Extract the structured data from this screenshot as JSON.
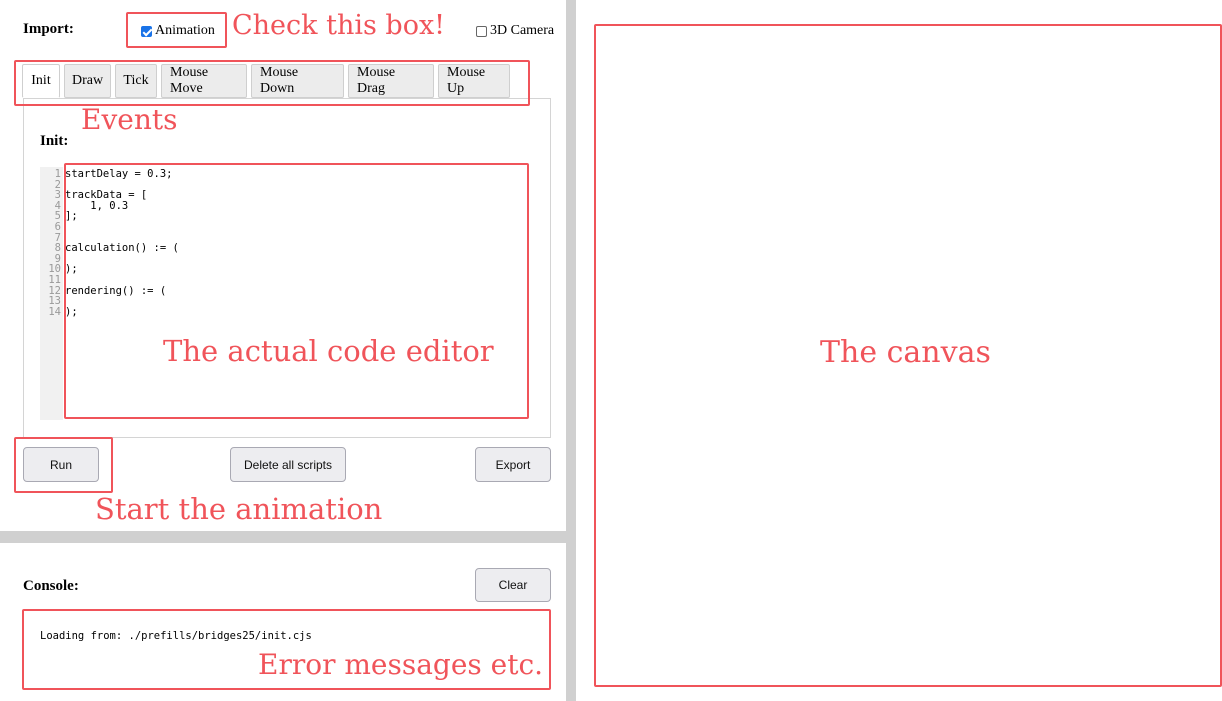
{
  "import": {
    "label": "Import:",
    "animation_label": "Animation",
    "animation_checked": true,
    "camera_label": "3D Camera",
    "camera_checked": false
  },
  "tabs": [
    {
      "label": "Init",
      "active": true
    },
    {
      "label": "Draw"
    },
    {
      "label": "Tick"
    },
    {
      "label": "Mouse Move"
    },
    {
      "label": "Mouse Down"
    },
    {
      "label": "Mouse Drag"
    },
    {
      "label": "Mouse Up"
    }
  ],
  "editor": {
    "heading": "Init:",
    "lines": [
      {
        "num": "1",
        "text": "startDelay = 0.3;"
      },
      {
        "num": "2",
        "text": ""
      },
      {
        "num": "3",
        "text": "trackData = ["
      },
      {
        "num": "4",
        "text": "    1, 0.3"
      },
      {
        "num": "5",
        "text": "];"
      },
      {
        "num": "6",
        "text": ""
      },
      {
        "num": "7",
        "text": ""
      },
      {
        "num": "8",
        "text": "calculation() := ("
      },
      {
        "num": "9",
        "text": ""
      },
      {
        "num": "10",
        "text": ");"
      },
      {
        "num": "11",
        "text": ""
      },
      {
        "num": "12",
        "text": "rendering() := ("
      },
      {
        "num": "13",
        "text": ""
      },
      {
        "num": "14",
        "text": ");"
      }
    ]
  },
  "buttons": {
    "run": "Run",
    "delete_all": "Delete all scripts",
    "export": "Export",
    "clear": "Clear"
  },
  "console": {
    "label": "Console:",
    "output": "Loading from: ./prefills/bridges25/init.cjs"
  },
  "annotations": {
    "check_box": "Check this box!",
    "events": "Events",
    "code_editor": "The actual code editor",
    "start": "Start the animation",
    "errors": "Error messages etc.",
    "canvas": "The canvas"
  },
  "colors": {
    "annotation": "#f0545a",
    "checkbox_accent": "#1a73e8",
    "splitter": "#d0d0d0"
  }
}
